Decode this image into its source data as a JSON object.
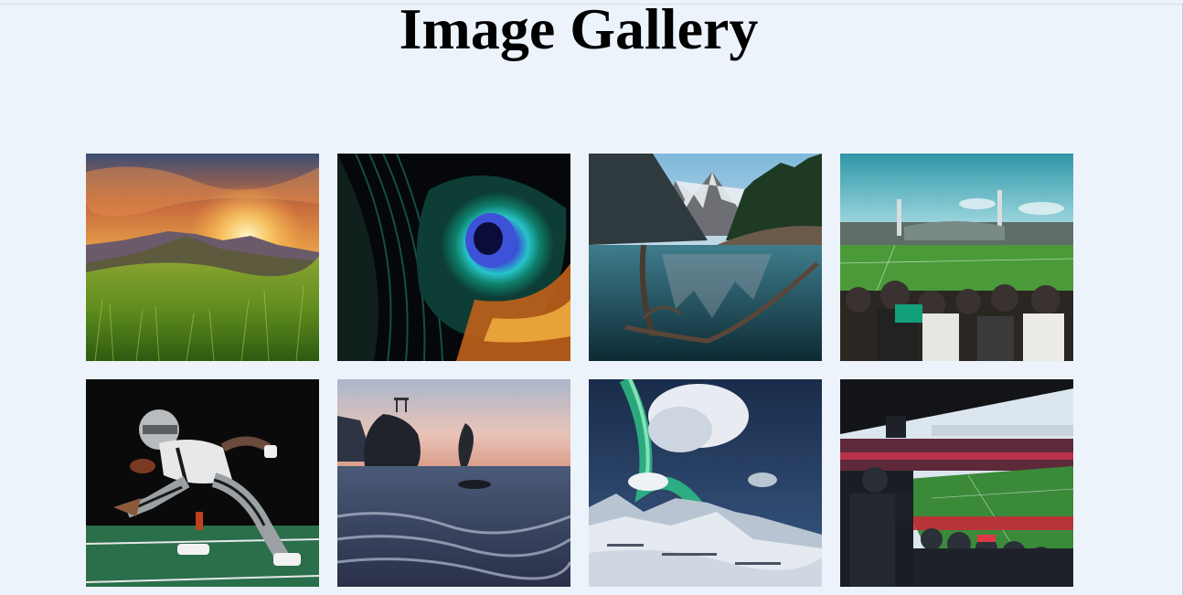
{
  "page": {
    "title": "Image Gallery"
  },
  "gallery": {
    "images": [
      {
        "subject": "mountain-sunset"
      },
      {
        "subject": "peacock-feather"
      },
      {
        "subject": "mountain-lake"
      },
      {
        "subject": "football-stadium"
      },
      {
        "subject": "football-player"
      },
      {
        "subject": "sea-rocks-sunset"
      },
      {
        "subject": "aurora-snowy-mountains"
      },
      {
        "subject": "stadium-crowd"
      }
    ]
  },
  "colors": {
    "background": "#edf3fb",
    "title": "#000000"
  }
}
